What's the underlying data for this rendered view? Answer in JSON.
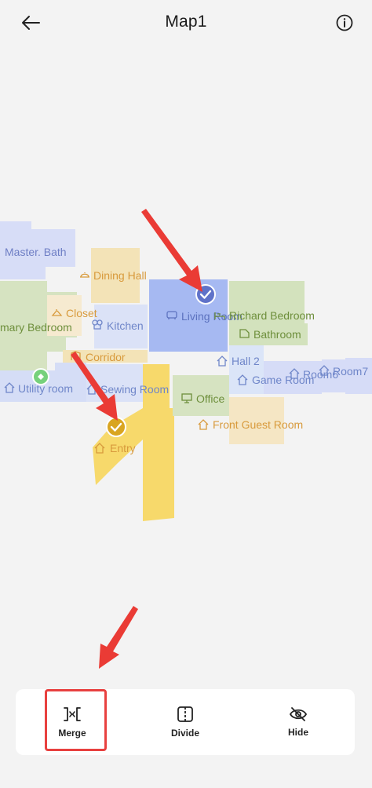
{
  "header": {
    "title": "Map1",
    "back_icon": "arrow-left-icon",
    "info_icon": "info-circle-icon"
  },
  "map": {
    "rooms": [
      {
        "label": "Master. Bath",
        "color": "#7a8fd1",
        "icon": "none"
      },
      {
        "label": "Dining Hall",
        "color": "#d89a3c",
        "icon": "dining-hall-icon"
      },
      {
        "label": "Closet",
        "color": "#d89a3c",
        "icon": "closet-icon"
      },
      {
        "label": "Kitchen",
        "color": "#6f86c9",
        "icon": "chef-hat-icon"
      },
      {
        "label": "Living Room",
        "color": "#5c72bf",
        "icon": "sofa-icon"
      },
      {
        "label": "Richard Bedroom",
        "color": "#6e8f3c",
        "icon": "bed-icon"
      },
      {
        "label": "Bathroom",
        "color": "#6e8f3c",
        "icon": "bathtub-icon"
      },
      {
        "label": "mary Bedroom",
        "color": "#6e8f3c",
        "icon": "none"
      },
      {
        "label": "Corridor",
        "color": "#d89a3c",
        "icon": "corridor-icon"
      },
      {
        "label": "Hall 2",
        "color": "#6f86c9",
        "icon": "home-icon"
      },
      {
        "label": "Room6",
        "color": "#6f86c9",
        "icon": "home-icon"
      },
      {
        "label": "Room7",
        "color": "#6f86c9",
        "icon": "home-icon"
      },
      {
        "label": "Game Room",
        "color": "#6f86c9",
        "icon": "home-icon"
      },
      {
        "label": "Utility room",
        "color": "#6f86c9",
        "icon": "home-icon"
      },
      {
        "label": "Sewing Room",
        "color": "#6f86c9",
        "icon": "home-icon"
      },
      {
        "label": "Office",
        "color": "#6e8f3c",
        "icon": "monitor-icon"
      },
      {
        "label": "Front Guest Room",
        "color": "#d89a3c",
        "icon": "home-icon"
      },
      {
        "label": "Entry",
        "color": "#d89a3c",
        "icon": "home-icon"
      }
    ]
  },
  "toolbar": {
    "merge_label": "Merge",
    "divide_label": "Divide",
    "hide_label": "Hide",
    "merge_icon": "merge-icon",
    "divide_icon": "divide-icon",
    "hide_icon": "eye-slash-icon"
  },
  "colors": {
    "room_blue": "#a9bbf2",
    "room_blue_light": "#d3dcf6",
    "room_green": "#cfe0b6",
    "room_yellow": "#f6e0a8",
    "room_gold": "#f7d96a",
    "room_orange": "#f5e6c4",
    "accent_arrow": "#ea3b35",
    "check_blue": "#5f72c9",
    "check_gold": "#d9a521",
    "check_green": "#6fcf7a"
  }
}
